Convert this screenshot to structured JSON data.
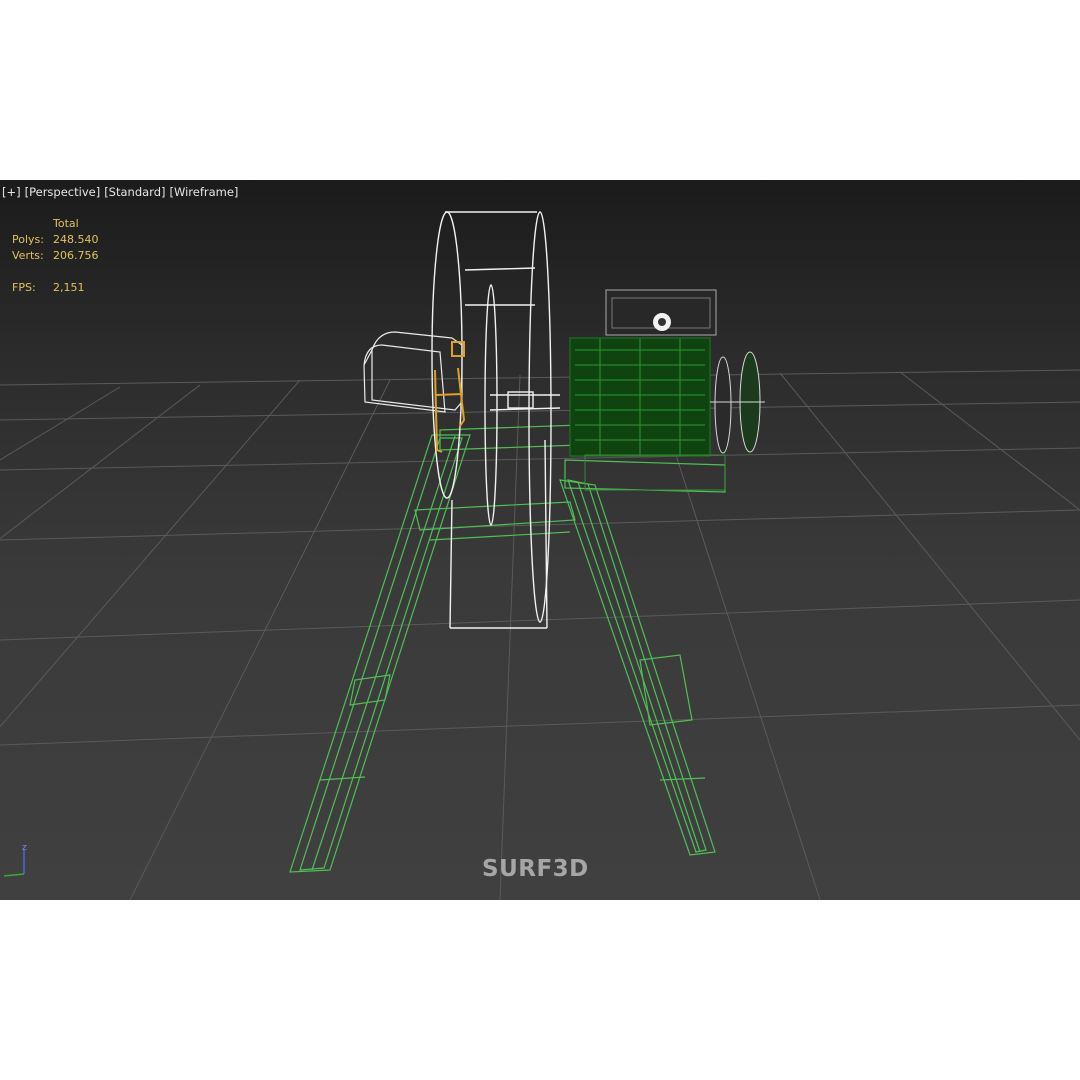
{
  "viewport": {
    "labels": [
      "[+]",
      "[Perspective]",
      "[Standard]",
      "[Wireframe]"
    ],
    "stats": {
      "header": "Total",
      "polys_label": "Polys:",
      "polys_value": "248.540",
      "verts_label": "Verts:",
      "verts_value": "206.756",
      "fps_label": "FPS:",
      "fps_value": "2,151"
    },
    "gizmo_axis_label": "z",
    "watermark": "SURF3D"
  },
  "colors": {
    "background_top": "#1b1b1b",
    "background_bottom": "#404040",
    "grid": "#5a5a5a",
    "stand_wireframe": "#4fbf55",
    "motor_wireframe": "#1f7a1f",
    "drum_wireframe": "#f2f2f2",
    "selected_bracket": "#e0a020",
    "stats_text": "#e2c25a"
  }
}
